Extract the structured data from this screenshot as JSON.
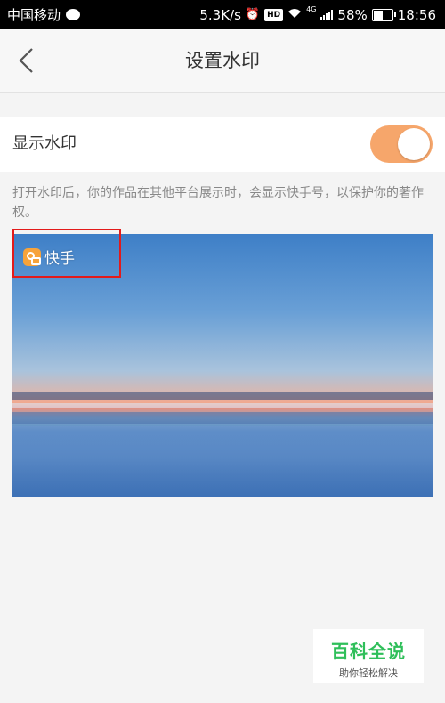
{
  "status_bar": {
    "carrier": "中国移动",
    "speed": "5.3K/s",
    "hd": "HD",
    "network": "4G",
    "battery": "58%",
    "battery_level": 0.58,
    "time": "18:56"
  },
  "header": {
    "title": "设置水印"
  },
  "settings": {
    "show_watermark_label": "显示水印",
    "toggle_on": true,
    "toggle_color": "#f6a66b"
  },
  "description": "打开水印后，你的作品在其他平台展示时，会显示快手号，以保护你的著作权。",
  "preview": {
    "watermark_text": "快手"
  },
  "badge": {
    "title": "百科全说",
    "subtitle": "助你轻松解决"
  }
}
